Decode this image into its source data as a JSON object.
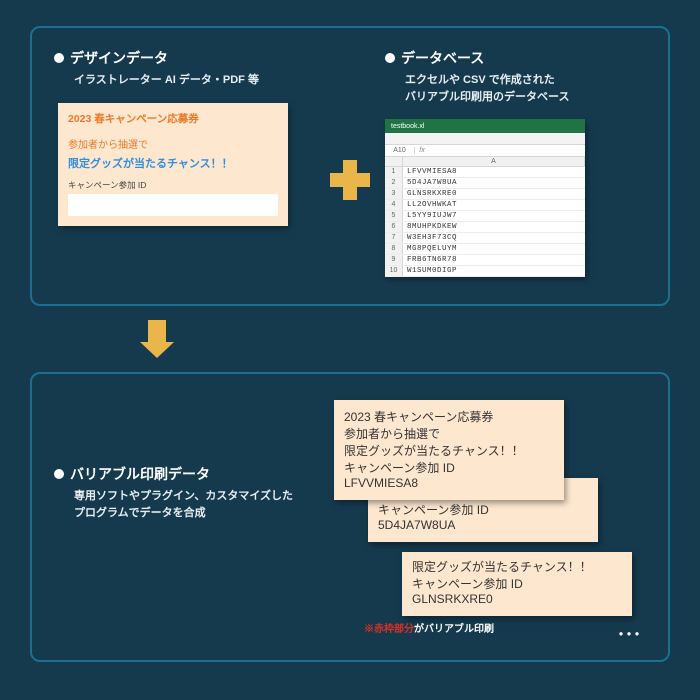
{
  "top": {
    "left": {
      "heading": "デザインデータ",
      "subhead": "イラストレーター AI データ・PDF 等"
    },
    "right": {
      "heading": "データベース",
      "subhead": "エクセルや CSV で作成された\nバリアブル印刷用のデータベース"
    }
  },
  "coupon": {
    "title": "2023 春キャンペーン応募券",
    "line1": "参加者から抽選で",
    "line2": "限定グッズが当たるチャンス！！",
    "id_label": "キャンペーン参加 ID"
  },
  "spreadsheet": {
    "filename": "testbook.xl",
    "cellref": "A10",
    "col_label": "A",
    "rows": [
      "LFVVMIESA8",
      "5D4JA7W8UA",
      "GLNSRKXRE0",
      "LL2OVHWKAT",
      "L5YY9IUJW7",
      "8MUHPKDKEW",
      "W3EH3F73CQ",
      "MG8PQELUYM",
      "FRB6TN6R78",
      "W1SUM0DIGP"
    ]
  },
  "bottom": {
    "heading": "バリアブル印刷データ",
    "subhead": "専用ソフトやプラグイン、カスタマイズした\nプログラムでデータを合成",
    "output_ids": [
      "LFVVMIESA8",
      "5D4JA7W8UA",
      "GLNSRKXRE0"
    ],
    "footnote_red": "※赤枠部分",
    "footnote_rest": "がバリアブル印刷"
  }
}
